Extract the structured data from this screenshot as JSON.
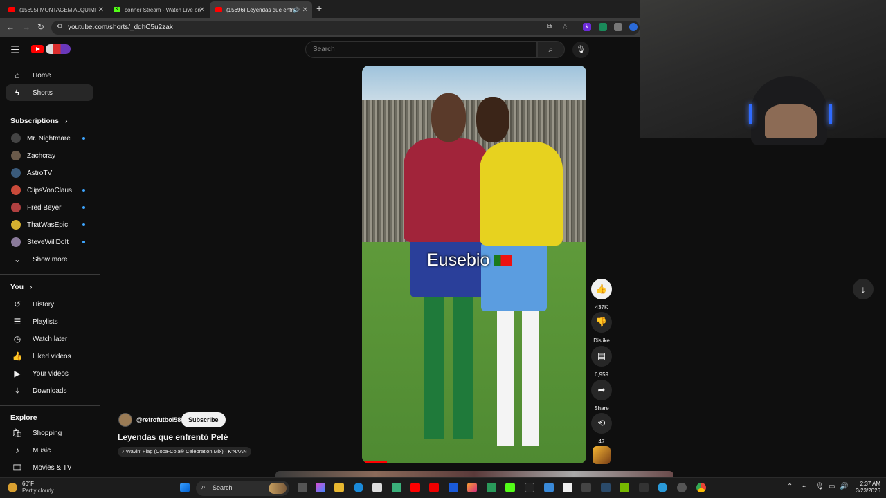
{
  "browser": {
    "tabs": [
      {
        "label": "(15695) MONTAGEM ALQUIMI",
        "favicon_color": "#ff0000"
      },
      {
        "label": "conner Stream - Watch Live on",
        "favicon_color": "#53fc18"
      },
      {
        "label": "(15696) Leyendas que enfre",
        "favicon_color": "#ff0000"
      }
    ],
    "url": "youtube.com/shorts/_dqhC5u2zak"
  },
  "search": {
    "placeholder": "Search"
  },
  "sidebar": {
    "main": [
      {
        "label": "Home",
        "icon": "home-icon"
      },
      {
        "label": "Shorts",
        "icon": "shorts-icon"
      }
    ],
    "subscriptions_header": "Subscriptions",
    "subscriptions": [
      {
        "label": "Mr. Nightmare",
        "avatar": "#444444",
        "new": true
      },
      {
        "label": "Zachcray",
        "avatar": "#6a5a4a",
        "new": false
      },
      {
        "label": "AstroTV",
        "avatar": "#3a5a7a",
        "new": false
      },
      {
        "label": "ClipsVonClaus",
        "avatar": "#c94a3a",
        "new": true
      },
      {
        "label": "Fred Beyer",
        "avatar": "#b04040",
        "new": true
      },
      {
        "label": "ThatWasEpic",
        "avatar": "#d4b030",
        "new": true
      },
      {
        "label": "SteveWillDoIt",
        "avatar": "#8a7a9a",
        "new": true
      }
    ],
    "show_more": "Show more",
    "you_header": "You",
    "you": [
      {
        "label": "History",
        "icon": "history-icon"
      },
      {
        "label": "Playlists",
        "icon": "playlists-icon"
      },
      {
        "label": "Watch later",
        "icon": "watch-later-icon"
      },
      {
        "label": "Liked videos",
        "icon": "like-icon"
      },
      {
        "label": "Your videos",
        "icon": "your-videos-icon"
      },
      {
        "label": "Downloads",
        "icon": "download-icon"
      }
    ],
    "explore_header": "Explore",
    "explore": [
      {
        "label": "Shopping",
        "icon": "shopping-icon"
      },
      {
        "label": "Music",
        "icon": "music-icon"
      },
      {
        "label": "Movies & TV",
        "icon": "movies-icon"
      }
    ]
  },
  "video": {
    "overlay_text": "Eusebio",
    "progress": 0.11
  },
  "actions": {
    "likes": "437K",
    "dislike": "Dislike",
    "comments": "6,959",
    "share": "Share",
    "remix": "47"
  },
  "channel": {
    "handle": "@retrofutbol58",
    "subscribe": "Subscribe",
    "title": "Leyendas que enfrentó Pelé",
    "music": "Wavin' Flag (Coca-Cola® Celebration Mix) · K'NAAN"
  },
  "taskbar": {
    "weather_temp": "60°F",
    "weather_desc": "Partly cloudy",
    "search": "Search",
    "time": "2:37 AM",
    "date": "3/23/2026"
  }
}
